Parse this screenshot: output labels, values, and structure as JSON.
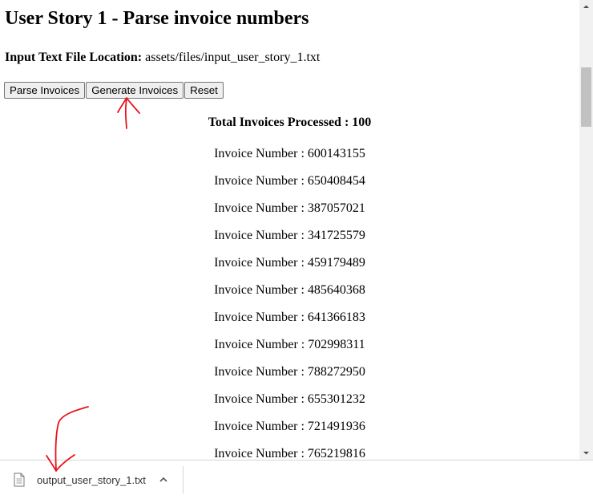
{
  "page": {
    "title": "User Story 1 - Parse invoice numbers",
    "file_location_label": "Input Text File Location:",
    "file_location_value": "assets/files/input_user_story_1.txt"
  },
  "buttons": {
    "parse": "Parse Invoices",
    "generate": "Generate Invoices",
    "reset": "Reset"
  },
  "summary": {
    "total_label": "Total Invoices Processed : 100"
  },
  "invoices": [
    "Invoice Number : 600143155",
    "Invoice Number : 650408454",
    "Invoice Number : 387057021",
    "Invoice Number : 341725579",
    "Invoice Number : 459179489",
    "Invoice Number : 485640368",
    "Invoice Number : 641366183",
    "Invoice Number : 702998311",
    "Invoice Number : 788272950",
    "Invoice Number : 655301232",
    "Invoice Number : 721491936",
    "Invoice Number : 765219816"
  ],
  "download": {
    "file_name": "output_user_story_1.txt",
    "file_icon": "document-icon",
    "options_icon": "chevron-up-icon"
  },
  "annotations": {
    "color": "#e8141b"
  }
}
